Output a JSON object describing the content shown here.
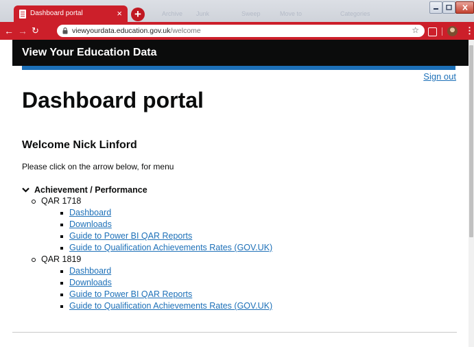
{
  "browser": {
    "tab_title": "Dashboard portal",
    "tab_close": "×",
    "new_tab": "+",
    "url_host": "viewyourdata.education.gov.uk",
    "url_path": "/welcome",
    "bookmarks_faded": [
      "Archive",
      "Junk",
      "Sweep",
      "Move to",
      "Categories"
    ]
  },
  "header": {
    "service_name": "View Your Education Data",
    "accent_color": "#1d70b8"
  },
  "sign_out": "Sign out",
  "page": {
    "title": "Dashboard portal",
    "welcome": "Welcome Nick Linford",
    "instructions": "Please click on the arrow below, for menu"
  },
  "menu": {
    "section": "Achievement / Performance",
    "groups": [
      {
        "label": "QAR 1718",
        "links": [
          "Dashboard",
          "Downloads",
          "Guide to Power BI QAR Reports",
          "Guide to Qualification Achievements Rates (GOV.UK)"
        ]
      },
      {
        "label": "QAR 1819",
        "links": [
          "Dashboard",
          "Downloads",
          "Guide to Power BI QAR Reports",
          "Guide to Qualification Achievements Rates (GOV.UK)"
        ]
      }
    ]
  },
  "colors": {
    "chrome_red": "#cc1f2a",
    "govuk_black": "#0b0c0c",
    "link_blue": "#1d70b8"
  }
}
